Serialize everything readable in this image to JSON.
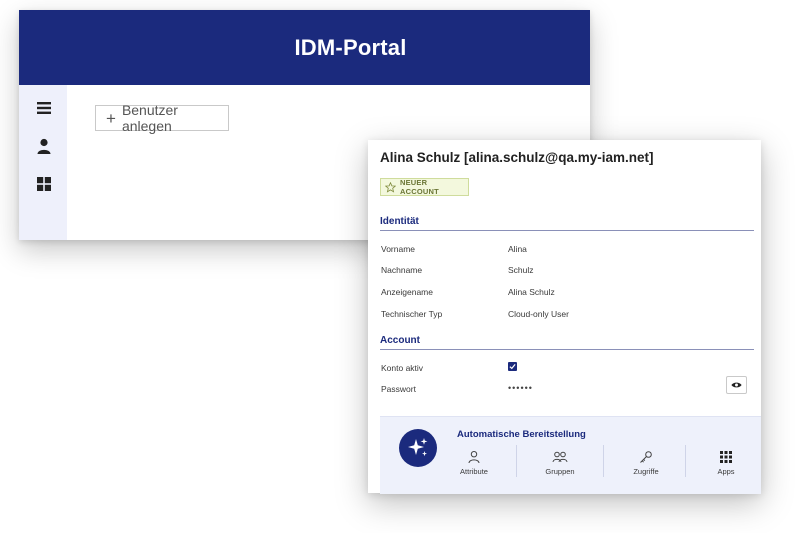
{
  "app": {
    "title": "IDM-Portal"
  },
  "sidebar": {
    "items": [
      {
        "icon": "menu-icon"
      },
      {
        "icon": "user-icon"
      },
      {
        "icon": "grid-icon"
      }
    ]
  },
  "toolbar": {
    "add_user_label": "Benutzer anlegen",
    "add_user_icon": "plus-icon"
  },
  "user_card": {
    "title": "Alina Schulz [alina.schulz@qa.my-iam.net]",
    "badge": {
      "label": "NEUER ACCOUNT",
      "icon": "star-icon"
    },
    "identity": {
      "section_title": "Identität",
      "rows": [
        {
          "label": "Vorname",
          "value": "Alina"
        },
        {
          "label": "Nachname",
          "value": "Schulz"
        },
        {
          "label": "Anzeigename",
          "value": "Alina Schulz"
        },
        {
          "label": "Technischer Typ",
          "value": "Cloud-only User"
        }
      ]
    },
    "account": {
      "section_title": "Account",
      "active_label": "Konto aktiv",
      "active_checked": true,
      "password_label": "Passwort",
      "password_value": "••••••"
    },
    "provisioning": {
      "title": "Automatische Bereitstellung",
      "icon": "sparkle-icon",
      "items": [
        {
          "label": "Attribute",
          "icon": "person-outline-icon"
        },
        {
          "label": "Gruppen",
          "icon": "group-icon"
        },
        {
          "label": "Zugriffe",
          "icon": "key-icon"
        },
        {
          "label": "Apps",
          "icon": "apps-grid-icon"
        }
      ]
    }
  },
  "colors": {
    "brand": "#1b2a7d",
    "sidebar_bg": "#eef0fb",
    "badge_bg": "#f3f8dd",
    "panel_bg": "#eef1fb"
  }
}
